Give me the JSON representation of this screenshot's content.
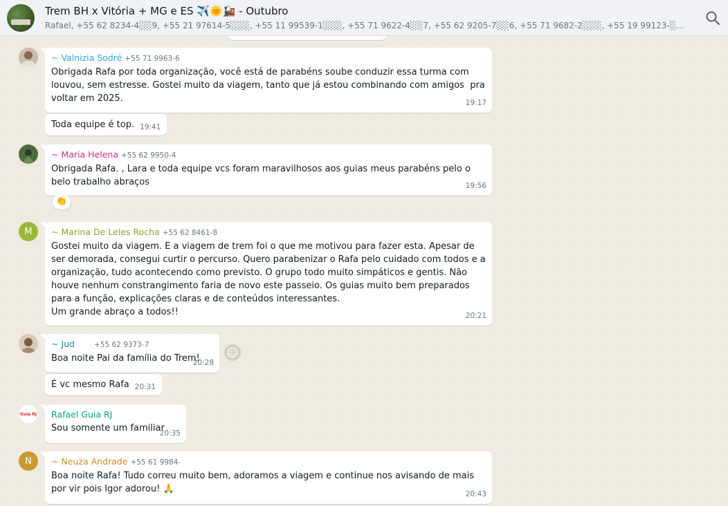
{
  "header": {
    "title": "Trem BH x Vitória + MG e ES ✈️🌞🚂 - Outubro",
    "participants": "Rafael, +55 62 8234-4░░9, +55 21 97614-5░░░, +55 11 99539-1░░░, +55 71 9622-4░░7, +55 62 9205-7░░6, +55 71 9682-2░░░, +55 19 99123-░░░░, +55 19 99..."
  },
  "colors": {
    "valnizia": "#35a3d4",
    "maria": "#d42a8a",
    "marina": "#8aa52f",
    "jud": "#1f7fb8",
    "rafael": "#06a47f",
    "neuza": "#cc8b1c"
  },
  "messages": [
    {
      "sender": "~ Valnizia Sodré",
      "phone": "+55 71 9963-6",
      "text": "Obrigada Rafa por toda organização, você está de parabéns soube conduzir essa turma com louvou, sem estresse. Gostei muito da viagem, tanto que já estou combinando com amigos  pra voltar em 2025.",
      "time": "19:17"
    },
    {
      "text": "Toda equipe é top.",
      "time": "19:41"
    },
    {
      "sender": "~ Maria Helena",
      "phone": "+55 62 9950-4",
      "text": "Obrigada Rafa. , Lara e toda equipe vcs foram maravilhosos aos guias meus parabéns pelo o belo trabalho abraços",
      "time": "19:56",
      "reaction": "👏"
    },
    {
      "sender": "~ Marina De Leles Rocha",
      "phone": "+55 62 8461-8",
      "avatar_letter": "M",
      "text": "Gostei muito da viagem. E a viagem de trem foi o que me motivou para fazer esta. Apesar de ser demorada, consegui curtir o percurso. Quero parabenizar o Rafa pelo cuidado com todos e a organização, tudo acontecendo como previsto. O grupo todo muito simpáticos e gentis. Não houve nenhum constrangimento faria de novo este passeio. Os guias muito bem preparados para a função, explicações claras e de conteúdos interessantes.\nUm grande abraço a todos!!",
      "time": "20:21"
    },
    {
      "sender": "~ Jud",
      "phone": "+55 62 9373-7",
      "text": "Boa noite Pai da família do Trem!",
      "time": "20:28"
    },
    {
      "text": "É vc mesmo Rafa",
      "time": "20:31"
    },
    {
      "sender": "Rafael Guia RJ",
      "avatar_text": "Guia RJ",
      "text": "Sou somente um familiar",
      "time": "20:35"
    },
    {
      "sender": "~ Neuza Andrade",
      "phone": "+55 61 9984-",
      "avatar_letter": "N",
      "text": "Boa noite Rafa! Tudo correu muito bem, adoramos a viagem e continue nos avisando de mais por vir pois Igor adorou! 🙏",
      "time": "20:43"
    }
  ]
}
